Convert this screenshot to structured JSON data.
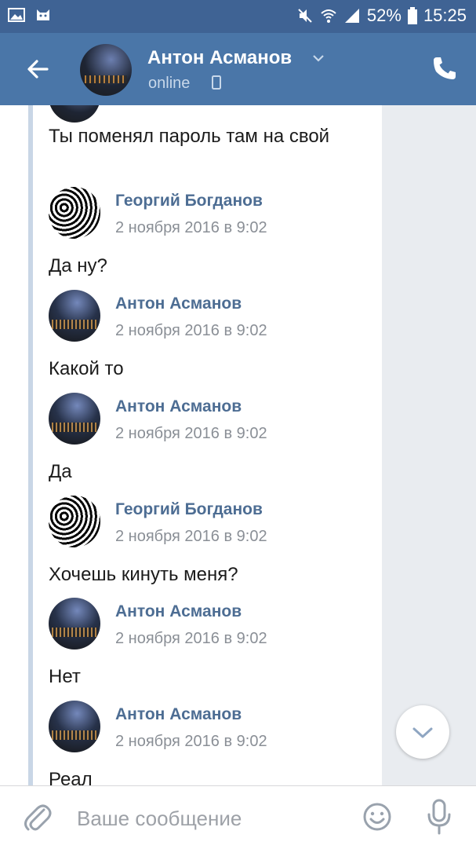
{
  "status_bar": {
    "battery": "52%",
    "time": "15:25"
  },
  "header": {
    "name": "Антон Асманов",
    "status": "online"
  },
  "messages": [
    {
      "type": "text",
      "text": "Ты поменял пароль там на свой"
    },
    {
      "type": "author",
      "author": "Георгий Богданов",
      "datetime": "2 ноября 2016 в 9:02",
      "text": "Да ну?"
    },
    {
      "type": "author",
      "author": "Антон Асманов",
      "datetime": "2 ноября 2016 в 9:02",
      "text": "Какой то"
    },
    {
      "type": "author",
      "author": "Антон Асманов",
      "datetime": "2 ноября 2016 в 9:02",
      "text": "Да"
    },
    {
      "type": "author",
      "author": "Георгий Богданов",
      "datetime": "2 ноября 2016 в 9:02",
      "text": "Хочешь кинуть меня?"
    },
    {
      "type": "author",
      "author": "Антон Асманов",
      "datetime": "2 ноября 2016 в 9:02",
      "text": "Нет"
    },
    {
      "type": "author",
      "author": "Антон Асманов",
      "datetime": "2 ноября 2016 в 9:02",
      "text": "Реал"
    }
  ],
  "composer": {
    "placeholder": "Ваше сообщение"
  },
  "colors": {
    "header_bg": "#4a76a8",
    "status_bg": "#3f6394",
    "author": "#4d6d93"
  }
}
